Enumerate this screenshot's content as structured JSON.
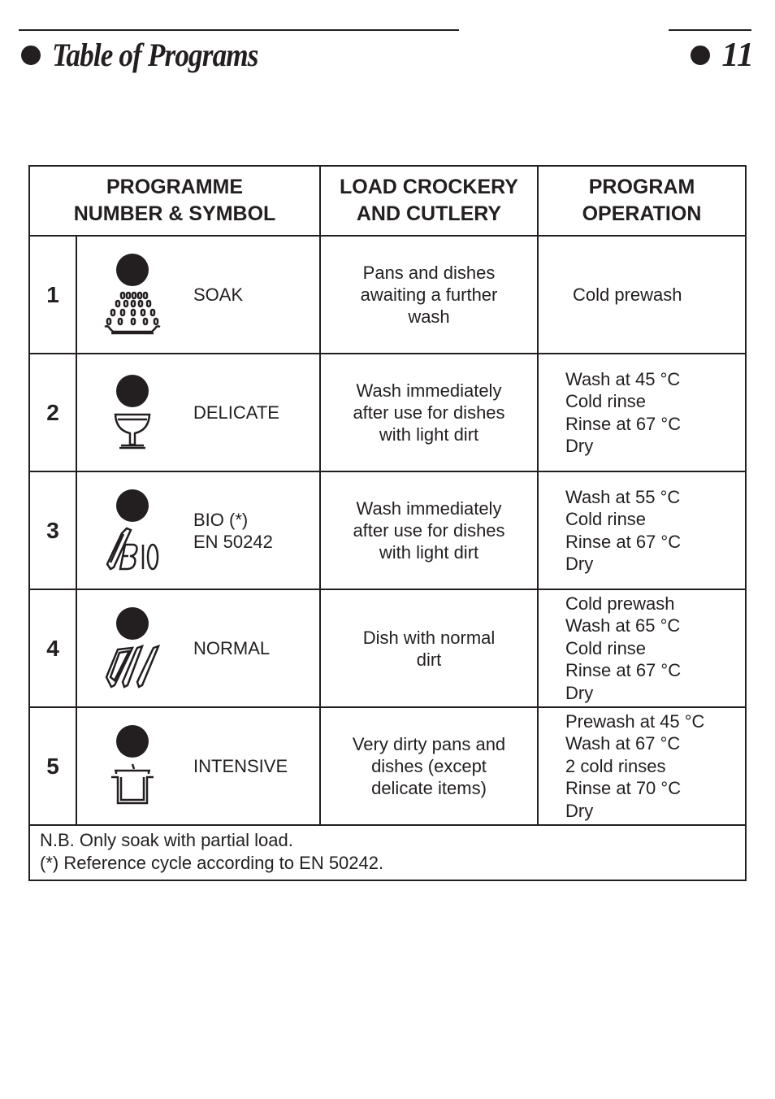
{
  "header": {
    "title": "Table of Programs",
    "page_number": "11"
  },
  "table": {
    "columns": [
      {
        "line1": "PROGRAMME",
        "line2": "NUMBER & SYMBOL"
      },
      {
        "line1": "LOAD CROCKERY",
        "line2": "AND CUTLERY"
      },
      {
        "line1": "PROGRAM",
        "line2": "OPERATION"
      }
    ],
    "rows": [
      {
        "number": "1",
        "symbol_icon": "soak-shower-icon",
        "name_lines": [
          "SOAK"
        ],
        "load_lines": [
          "Pans and dishes",
          "awaiting a further",
          "wash"
        ],
        "operation_lines": [
          "Cold prewash"
        ]
      },
      {
        "number": "2",
        "symbol_icon": "glass-icon",
        "name_lines": [
          "DELICATE"
        ],
        "load_lines": [
          "Wash immediately",
          "after use for dishes",
          "with light dirt"
        ],
        "operation_lines": [
          "Wash at 45 °C",
          "Cold rinse",
          "Rinse at 67 °C",
          "Dry"
        ]
      },
      {
        "number": "3",
        "symbol_icon": "bio-plate-icon",
        "name_lines": [
          "BIO (*)",
          "EN 50242"
        ],
        "load_lines": [
          "Wash immediately",
          "after use for dishes",
          "with light dirt"
        ],
        "operation_lines": [
          "Wash at 55 °C",
          "Cold rinse",
          "Rinse at 67 °C",
          "Dry"
        ]
      },
      {
        "number": "4",
        "symbol_icon": "three-plates-icon",
        "name_lines": [
          "NORMAL"
        ],
        "load_lines": [
          "Dish with normal",
          "dirt"
        ],
        "operation_lines": [
          "Cold prewash",
          "Wash at 65 °C",
          "Cold rinse",
          "Rinse at 67 °C",
          "Dry"
        ]
      },
      {
        "number": "5",
        "symbol_icon": "pot-icon",
        "name_lines": [
          "INTENSIVE"
        ],
        "load_lines": [
          "Very dirty pans and",
          "dishes (except",
          "delicate items)"
        ],
        "operation_lines": [
          "Prewash at 45 °C",
          "Wash at 67 °C",
          "2 cold rinses",
          "Rinse at 70 °C",
          "Dry"
        ]
      }
    ],
    "footnotes": [
      "N.B. Only soak with partial load.",
      "(*) Reference cycle according to EN 50242."
    ]
  }
}
